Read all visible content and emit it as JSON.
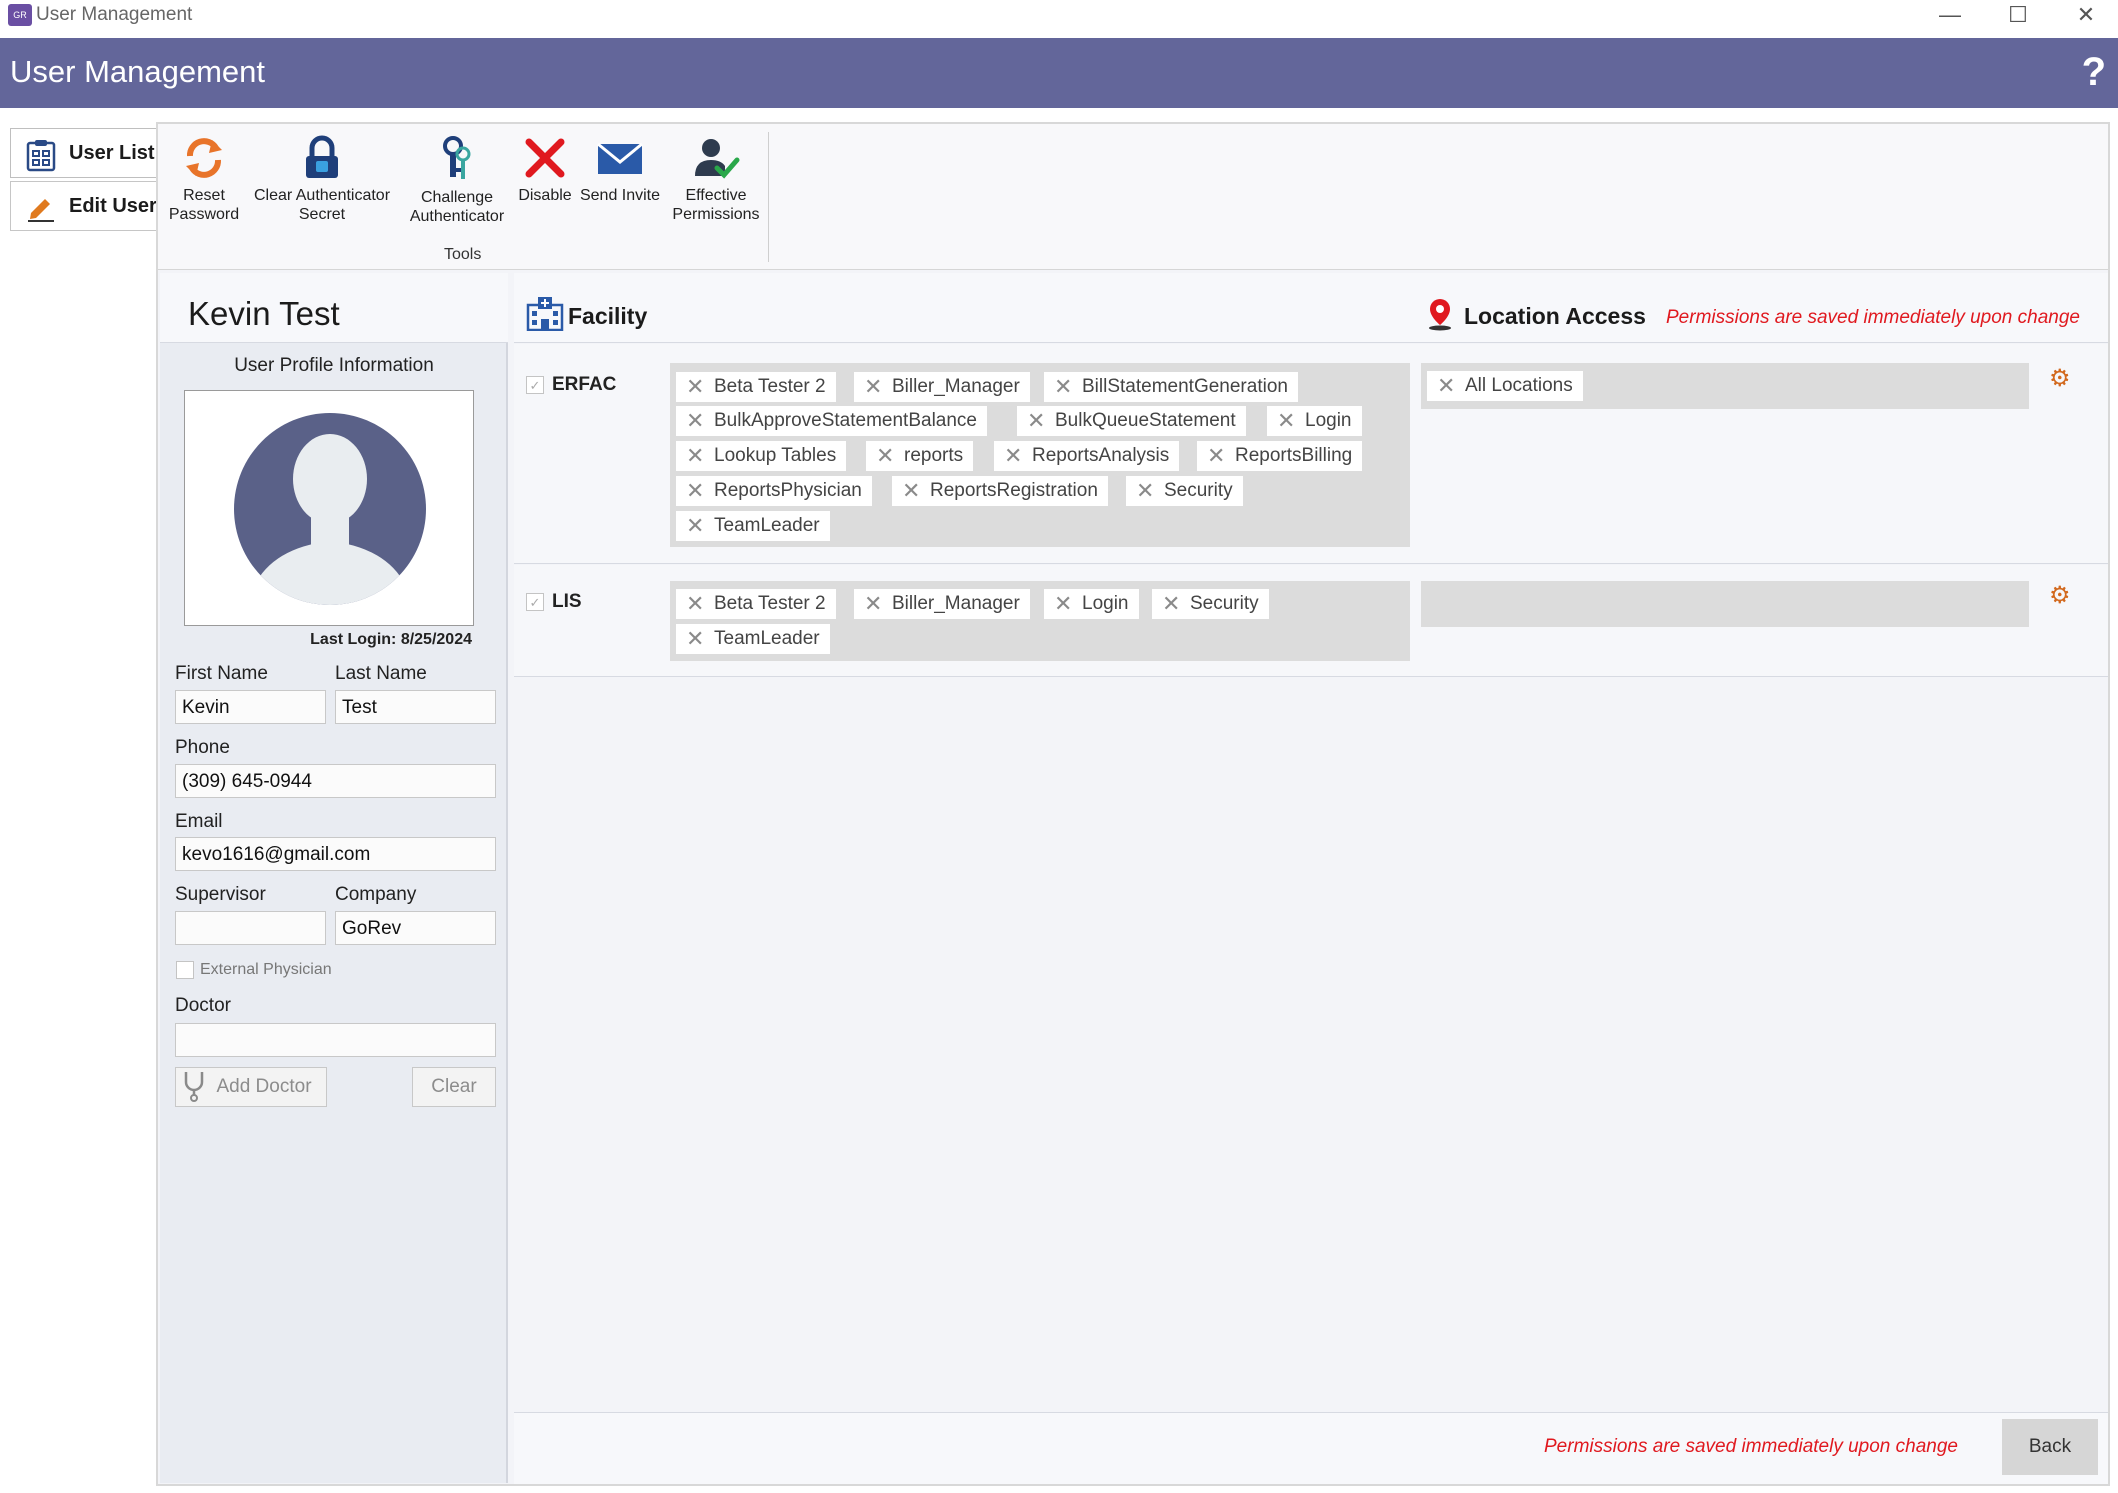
{
  "window": {
    "title": "User Management",
    "minimize": "—",
    "maximize": "☐",
    "close": "✕"
  },
  "header": {
    "title": "User Management",
    "help": "?"
  },
  "nav": {
    "items": [
      {
        "label": "User List"
      },
      {
        "label": "Edit User"
      }
    ]
  },
  "ribbon": {
    "buttons": [
      {
        "line1": "Reset",
        "line2": "Password"
      },
      {
        "line1": "Clear Authenticator",
        "line2": "Secret"
      },
      {
        "line1": "Challenge",
        "line2": "Authenticator"
      },
      {
        "line1": "Disable",
        "line2": ""
      },
      {
        "line1": "Send Invite",
        "line2": ""
      },
      {
        "line1": "Effective",
        "line2": "Permissions"
      }
    ],
    "group_label": "Tools"
  },
  "profile": {
    "name": "Kevin Test",
    "section_title": "User Profile Information",
    "last_login": "Last Login: 8/25/2024",
    "first_name_label": "First Name",
    "first_name": "Kevin",
    "last_name_label": "Last Name",
    "last_name": "Test",
    "phone_label": "Phone",
    "phone": "(309) 645-0944",
    "email_label": "Email",
    "email": "kevo1616@gmail.com",
    "supervisor_label": "Supervisor",
    "supervisor": "",
    "company_label": "Company",
    "company": "GoRev",
    "external_physician_label": "External Physician",
    "doctor_label": "Doctor",
    "doctor": "",
    "add_doctor": "Add Doctor",
    "clear": "Clear"
  },
  "facility_panel": {
    "facility_title": "Facility",
    "location_title": "Location Access",
    "notice": "Permissions are saved immediately upon change",
    "rows": [
      {
        "name": "ERFAC",
        "roles": [
          "Beta Tester 2",
          "Biller_Manager",
          "BillStatementGeneration",
          "BulkApproveStatementBalance",
          "BulkQueueStatement",
          "Login",
          "Lookup Tables",
          "reports",
          "ReportsAnalysis",
          "ReportsBilling",
          "ReportsPhysician",
          "ReportsRegistration",
          "Security",
          "TeamLeader"
        ],
        "locations": [
          "All Locations"
        ]
      },
      {
        "name": "LIS",
        "roles": [
          "Beta Tester 2",
          "Biller_Manager",
          "Login",
          "Security",
          "TeamLeader"
        ],
        "locations": []
      }
    ]
  },
  "footer": {
    "notice": "Permissions are saved immediately upon change",
    "back": "Back"
  },
  "colors": {
    "header": "#63669a",
    "notice": "#e0191f",
    "avatar": "#5a6188"
  }
}
